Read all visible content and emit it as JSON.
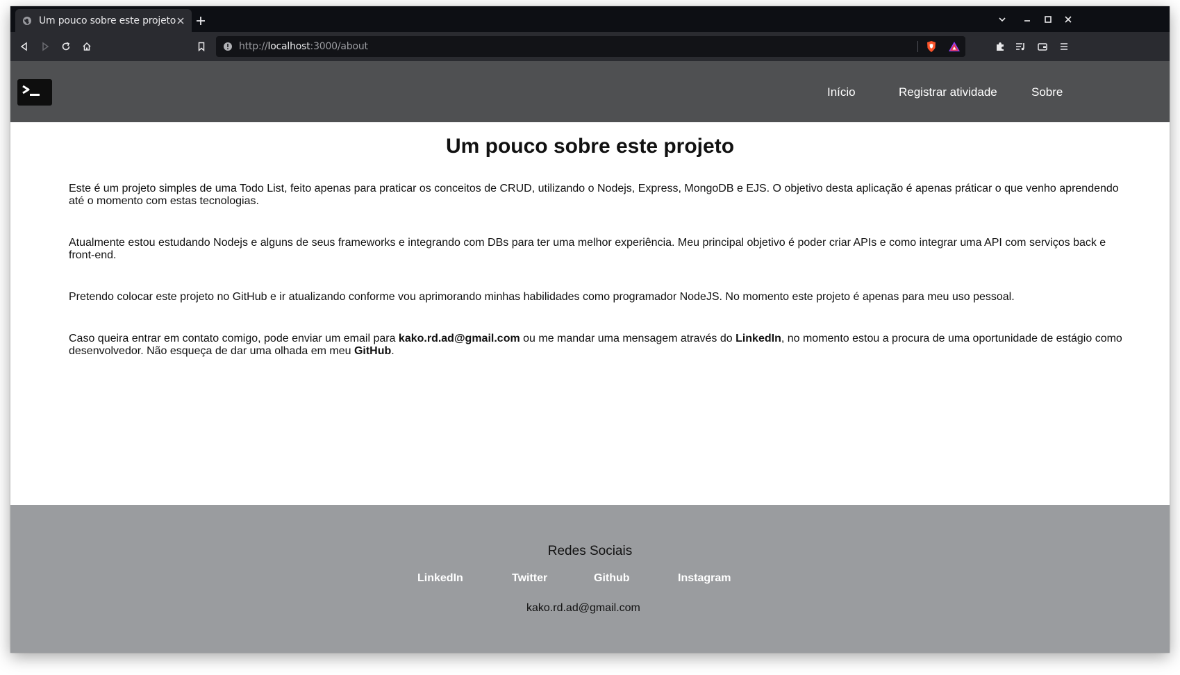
{
  "browser": {
    "tab_title": "Um pouco sobre este projeto",
    "tab_favicon_icon": "globe-icon",
    "url_scheme": "http://",
    "url_host": "localhost",
    "url_path": ":3000/about"
  },
  "site": {
    "logo_icon": "terminal-prompt-icon",
    "nav": [
      {
        "label": "Início"
      },
      {
        "label": "Registrar atividade"
      },
      {
        "label": "Sobre"
      }
    ]
  },
  "content": {
    "title": "Um pouco sobre este projeto",
    "p1": "Este é um projeto simples de uma Todo List, feito apenas para praticar os conceitos de CRUD, utilizando o Nodejs, Express, MongoDB e EJS. O objetivo desta aplicação é apenas práticar o que venho aprendendo até o momento com estas tecnologias.",
    "p2": "Atualmente estou estudando Nodejs e alguns de seus frameworks e integrando com DBs para ter uma melhor experiência. Meu principal objetivo é poder criar APIs e como integrar uma API com serviços back e front-end.",
    "p3": "Pretendo colocar este projeto no GitHub e ir atualizando conforme vou aprimorando minhas habilidades como programador NodeJS. No momento este projeto é apenas para meu uso pessoal.",
    "p4": {
      "part1": "Caso queira entrar em contato comigo, pode enviar um email para ",
      "email": "kako.rd.ad@gmail.com",
      "part2": " ou me mandar uma mensagem através do ",
      "linkedin": "LinkedIn",
      "part3": ", no momento estou a procura de uma oportunidade de estágio como desenvolvedor. Não esqueça de dar uma olhada em meu ",
      "github": "GitHub",
      "part4": "."
    }
  },
  "footer": {
    "title": "Redes Sociais",
    "links": [
      {
        "label": "LinkedIn"
      },
      {
        "label": "Twitter"
      },
      {
        "label": "Github"
      },
      {
        "label": "Instagram"
      }
    ],
    "email": "kako.rd.ad@gmail.com"
  },
  "colors": {
    "nav_bg": "#4f5052",
    "footer_bg": "#9a9c9f",
    "browser_frame": "#0d0f14",
    "toolbar": "#2a2b30"
  }
}
